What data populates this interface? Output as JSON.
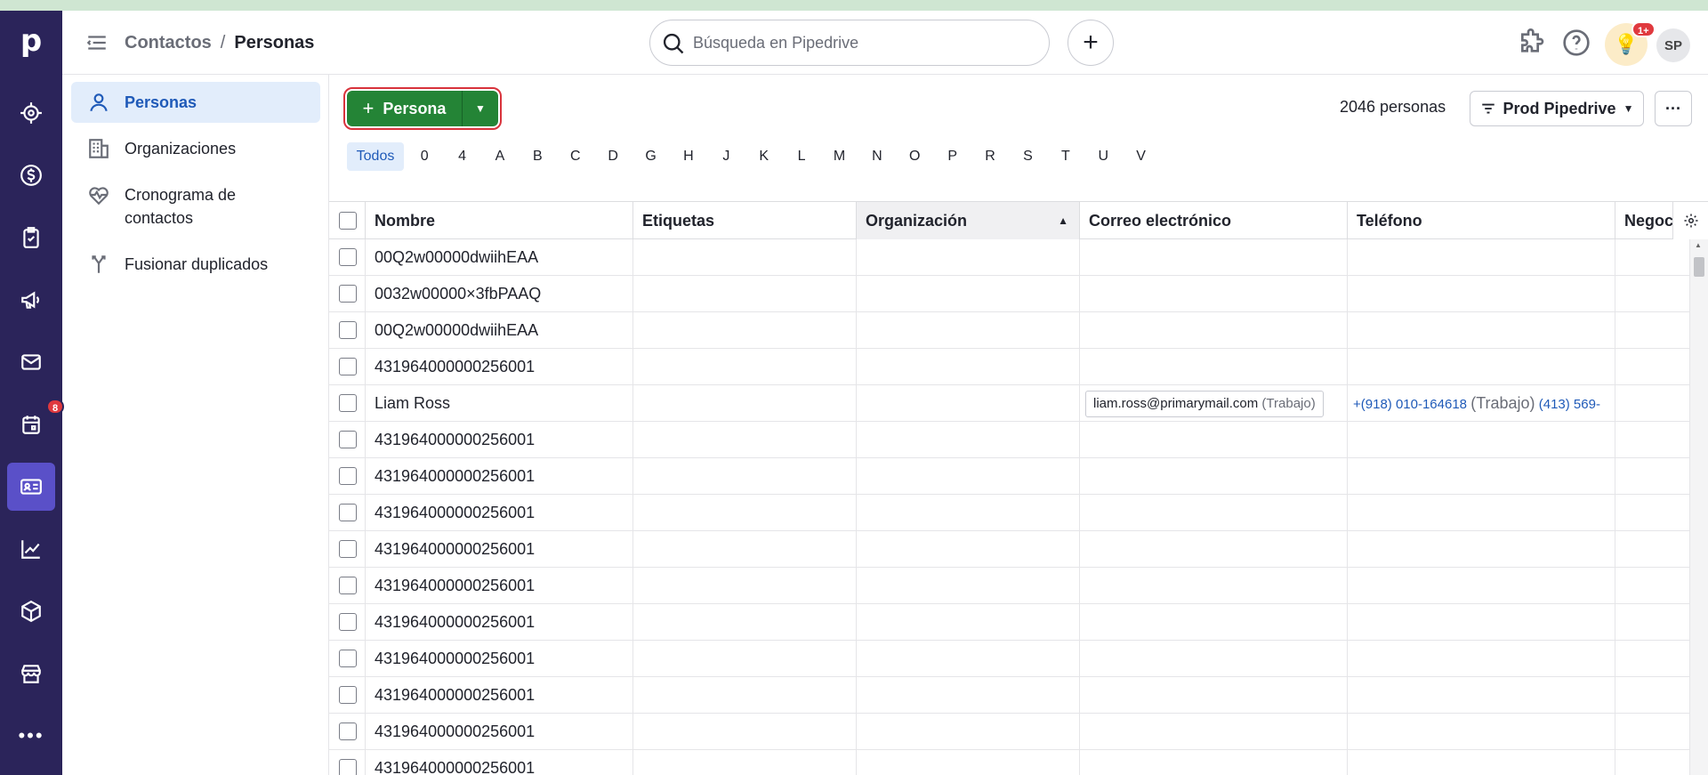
{
  "header": {
    "breadcrumb_parent": "Contactos",
    "breadcrumb_sep": "/",
    "breadcrumb_current": "Personas",
    "search_placeholder": "Búsqueda en Pipedrive",
    "add_label": "+",
    "tips_badge": "1+",
    "avatar_initials": "SP"
  },
  "rail": {
    "logo": "p",
    "activities_badge": "8",
    "more_label": "•••",
    "icons": [
      "target-icon",
      "dollar-icon",
      "clipboard-check-icon",
      "megaphone-icon",
      "mail-icon",
      "calendar-icon",
      "contact-card-icon",
      "chart-icon",
      "box-icon",
      "store-icon"
    ]
  },
  "sidenav": {
    "items": [
      {
        "label": "Personas",
        "icon": "person-icon",
        "active": true
      },
      {
        "label": "Organizaciones",
        "icon": "building-icon"
      },
      {
        "label": "Cronograma de contactos",
        "icon": "heartbeat-icon"
      },
      {
        "label": "Fusionar duplicados",
        "icon": "merge-icon"
      }
    ]
  },
  "toolbar": {
    "new_button_label": "Persona",
    "count_text": "2046 personas",
    "filter_label": "Prod Pipedrive",
    "more_label": "···"
  },
  "alphabet": [
    "Todos",
    "0",
    "4",
    "A",
    "B",
    "C",
    "D",
    "G",
    "H",
    "J",
    "K",
    "L",
    "M",
    "N",
    "O",
    "P",
    "R",
    "S",
    "T",
    "U",
    "V"
  ],
  "table": {
    "columns": [
      "Nombre",
      "Etiquetas",
      "Organización",
      "Correo electrónico",
      "Teléfono",
      "Negocios"
    ],
    "rows": [
      {
        "name": "00Q2w00000dwiihEAA"
      },
      {
        "name": "0032w00000×3fbPAAQ"
      },
      {
        "name": "00Q2w00000dwiihEAA"
      },
      {
        "name": "431964000000256001"
      },
      {
        "name": "Liam Ross",
        "email": "liam.ross@primarymail.com",
        "email_type": "(Trabajo)",
        "phone1": "+(918) 010-164618",
        "phone_type": "(Trabajo)",
        "phone2": "(413) 569-"
      },
      {
        "name": "431964000000256001"
      },
      {
        "name": "431964000000256001"
      },
      {
        "name": "431964000000256001"
      },
      {
        "name": "431964000000256001"
      },
      {
        "name": "431964000000256001"
      },
      {
        "name": "431964000000256001"
      },
      {
        "name": "431964000000256001"
      },
      {
        "name": "431964000000256001"
      },
      {
        "name": "431964000000256001"
      },
      {
        "name": "431964000000256001"
      }
    ]
  },
  "colors": {
    "rail_bg": "#2b245a",
    "primary_green": "#248436",
    "accent_blue": "#1f5ab8",
    "badge_red": "#e0393e"
  }
}
